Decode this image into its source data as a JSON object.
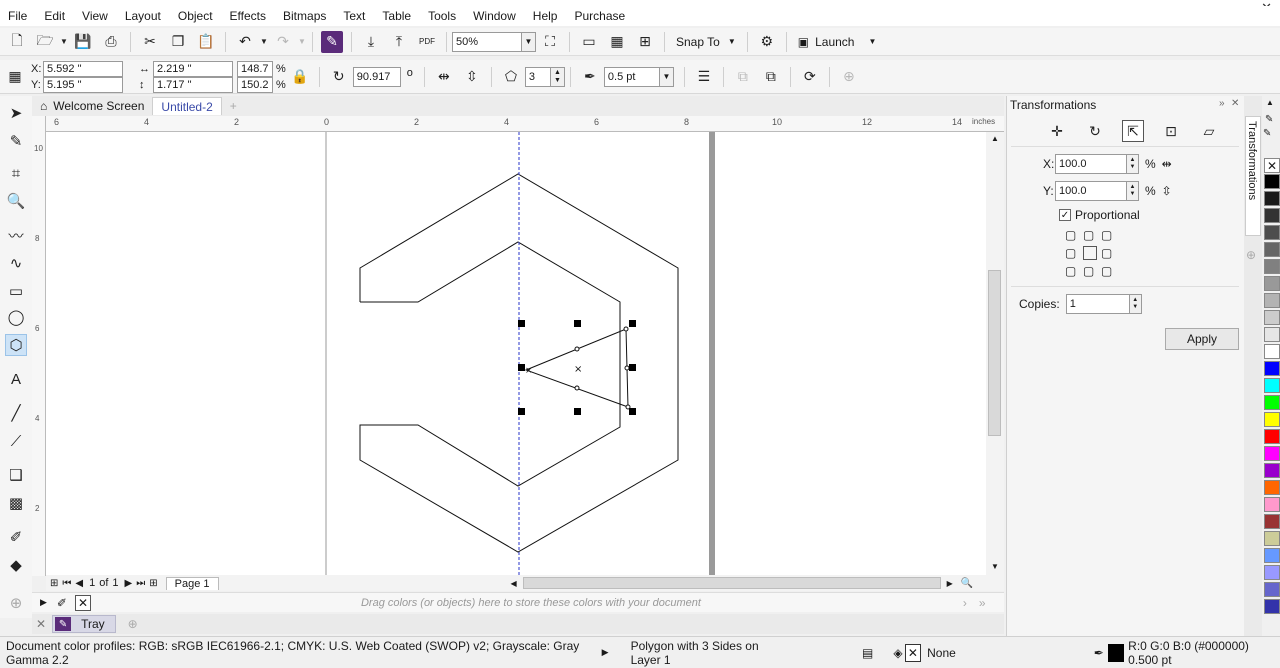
{
  "menu": [
    "File",
    "Edit",
    "View",
    "Layout",
    "Object",
    "Effects",
    "Bitmaps",
    "Text",
    "Table",
    "Tools",
    "Window",
    "Help",
    "Purchase"
  ],
  "toolbar": {
    "zoom": "50%",
    "snap_to": "Snap To",
    "launch": "Launch"
  },
  "propertybar": {
    "x_label": "X:",
    "x_value": "5.592 \"",
    "y_label": "Y:",
    "y_value": "5.195 \"",
    "width_value": "2.219 \"",
    "height_value": "1.717 \"",
    "scale_w": "148.7",
    "scale_h": "150.2",
    "percent": "%",
    "rotation": "90.917",
    "degree": "o",
    "sides": "3",
    "outline": "0.5 pt"
  },
  "tabs": [
    {
      "label": "Welcome Screen"
    },
    {
      "label": "Untitled-2"
    }
  ],
  "ruler": {
    "h_labels": [
      "6",
      "4",
      "2",
      "0",
      "2",
      "4",
      "6",
      "8",
      "10",
      "12",
      "14"
    ],
    "unit": "inches",
    "v_labels": [
      "10",
      "8",
      "6",
      "4",
      "2"
    ]
  },
  "pagenav": {
    "current": "1",
    "of": "of",
    "total": "1",
    "page_tab": "Page 1"
  },
  "docpalette_hint": "Drag colors (or objects) here to store these colors with your document",
  "tray_label": "Tray",
  "status": {
    "profiles": "Document color profiles: RGB: sRGB IEC61966-2.1; CMYK: U.S. Web Coated (SWOP) v2; Grayscale: Gray Gamma 2.2",
    "object": "Polygon with 3 Sides on Layer 1",
    "fill_text": "None",
    "outline_text": "R:0 G:0 B:0 (#000000)  0.500 pt"
  },
  "docker": {
    "title": "Transformations",
    "x_label": "X:",
    "x_value": "100.0",
    "y_label": "Y:",
    "y_value": "100.0",
    "percent": "%",
    "proportional": "Proportional",
    "copies_label": "Copies:",
    "copies_value": "1",
    "apply": "Apply",
    "side_tab": "Transformations"
  },
  "palette_colors": [
    "#000000",
    "#1a1a1a",
    "#333333",
    "#4d4d4d",
    "#666666",
    "#808080",
    "#999999",
    "#b3b3b3",
    "#cccccc",
    "#e6e6e6",
    "#ffffff",
    "#0000ff",
    "#00ffff",
    "#00ff00",
    "#ffff00",
    "#ff0000",
    "#ff00ff",
    "#9900cc",
    "#ff6600",
    "#ff99cc",
    "#993333",
    "#cccc99",
    "#6699ff",
    "#9999ff",
    "#6666cc",
    "#3333aa"
  ],
  "accent": "#3a4aa8"
}
